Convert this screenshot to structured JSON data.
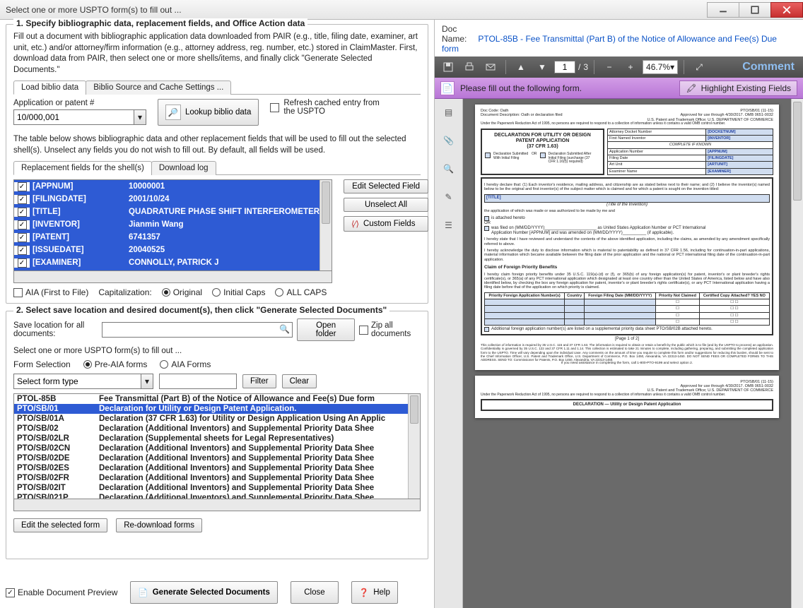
{
  "window": {
    "title": "Select one or more USPTO form(s) to fill out ..."
  },
  "section1": {
    "legend": "1. Specify bibliographic data, replacement fields, and Office Action data",
    "desc": "Fill out a document with bibliographic application data downloaded from PAIR (e.g., title, filing date, examiner, art unit, etc.) and/or attorney/firm information (e.g., attorney address, reg. number, etc.) stored in ClaimMaster. First, download data from PAIR, then select one or more shells/items, and finally click \"Generate Selected Documents.\"",
    "tabs": {
      "active": "Load biblio data",
      "other": "Biblio Source and Cache Settings ..."
    },
    "appnum_label": "Application or patent #",
    "appnum_value": "10/000,001",
    "lookup_btn": "Lookup biblio data",
    "refresh_label": "Refresh cached entry from the USPTO",
    "table_intro": "The table below shows bibliographic data and other replacement fields that will be used to fill out the selected shell(s). Unselect any fields you do not wish to fill out. By default, all fields will be used.",
    "rep_tabs": {
      "active": "Replacement fields for the shell(s)",
      "other": "Download log"
    },
    "fields": [
      {
        "key": "[APPNUM]",
        "val": "10000001"
      },
      {
        "key": "[FILINGDATE]",
        "val": "2001/10/24"
      },
      {
        "key": "[TITLE]",
        "val": "QUADRATURE PHASE SHIFT INTERFEROMETER"
      },
      {
        "key": "[INVENTOR]",
        "val": "Jianmin  Wang"
      },
      {
        "key": "[PATENT]",
        "val": "6741357"
      },
      {
        "key": "[ISSUEDATE]",
        "val": "20040525"
      },
      {
        "key": "[EXAMINER]",
        "val": "CONNOLLY, PATRICK J"
      }
    ],
    "edit_btn": "Edit Selected Field",
    "unselect_btn": "Unselect All",
    "custom_btn": "Custom Fields",
    "aia_label": "AIA (First to File)",
    "cap_label": "Capitalization:",
    "cap_opts": {
      "orig": "Original",
      "init": "Initial Caps",
      "caps": "ALL CAPS"
    }
  },
  "section2": {
    "legend": "2. Select save location and desired document(s), then click \"Generate Selected Documents\"",
    "save_label": "Save location for all documents:",
    "save_value": "",
    "open_folder": "Open folder",
    "zip_label": "Zip all documents",
    "select_hint": "Select one or more USPTO form(s) to fill out ...",
    "formsel_label": "Form Selection",
    "pre_aia": "Pre-AIA forms",
    "aia_forms": "AIA Forms",
    "formtype_placeholder": "Select form type",
    "filter_placeholder": "",
    "filter_btn": "Filter",
    "clear_btn": "Clear",
    "forms": [
      {
        "id": "PTOL-85B",
        "name": "Fee Transmittal (Part B) of the Notice of Allowance and Fee(s) Due form",
        "sel": false,
        "hdr": true
      },
      {
        "id": "PTO/SB/01",
        "name": "Declaration for Utility or Design Patent Application.",
        "sel": true
      },
      {
        "id": "PTO/SB/01A",
        "name": "Declaration (37 CFR 1.63) for Utility or Design Application Using An Applic"
      },
      {
        "id": "PTO/SB/02",
        "name": "Declaration (Additional Inventors) and Supplemental Priority Data Shee"
      },
      {
        "id": "PTO/SB/02LR",
        "name": "Declaration (Supplemental sheets for Legal Representatives)"
      },
      {
        "id": "PTO/SB/02CN",
        "name": "Declaration (Additional Inventors) and Supplemental Priority Data Shee"
      },
      {
        "id": "PTO/SB/02DE",
        "name": "Declaration (Additional Inventors) and Supplemental Priority Data Shee"
      },
      {
        "id": "PTO/SB/02ES",
        "name": "Declaration (Additional Inventors) and Supplemental Priority Data Shee"
      },
      {
        "id": "PTO/SB/02FR",
        "name": "Declaration (Additional Inventors) and Supplemental Priority Data Shee"
      },
      {
        "id": "PTO/SB/02IT",
        "name": "Declaration (Additional Inventors) and Supplemental Priority Data Shee"
      },
      {
        "id": "PTO/SB/021P",
        "name": "Declaration (Additional Inventors) and Supplemental Priority Data Shee"
      }
    ],
    "edit_form_btn": "Edit the selected form",
    "redownload_btn": "Re-download forms"
  },
  "bottom": {
    "preview_label": "Enable Document Preview",
    "generate_btn": "Generate Selected Documents",
    "close_btn": "Close",
    "help_btn": "Help"
  },
  "right": {
    "docname_lbl": "Doc Name:",
    "docname_val": "PTOL-85B - Fee Transmittal (Part B) of the Notice of Allowance and Fee(s) Due form",
    "page_cur": "1",
    "page_total": "3",
    "zoom": "46.7%",
    "comment": "Comment",
    "banner": "Please fill out the following form.",
    "highlight_btn": "Highlight Existing Fields",
    "pdf": {
      "doccode": "Doc Code: Oath",
      "docdesc": "Document Description: Oath or declaration filed",
      "approved": "Approved for use through 4/30/2017. OMB 0651-0032",
      "agency": "U.S. Patent and Trademark Office; U.S. DEPARTMENT OF COMMERCE",
      "pra": "Under the Paperwork Reduction Act of 1995, no persons are required to respond to a collection of information unless it contains a valid OMB control number.",
      "decl1": "DECLARATION FOR UTILITY OR DESIGN",
      "decl2": "PATENT APPLICATION",
      "decl3": "(37 CFR 1.63)",
      "subA": "Declaration Submitted With Initial Filing",
      "subOR": "OR",
      "subB": "Declaration Submitted After Initial Filing (surcharge (37 CFR 1.16(f)) required)",
      "rows": {
        "r1l": "Attorney Docket Number",
        "r1v": "[DOCKETNUM]",
        "r2l": "First Named Inventor",
        "r2v": "[INVENTOR]",
        "r2c": "COMPLETE IF KNOWN",
        "r3l": "Application Number",
        "r3v": "[APPNUM]",
        "r4l": "Filing Date",
        "r4v": "[FILINGDATE]",
        "r5l": "Art Unit",
        "r5v": "[ARTUNIT]",
        "r6l": "Examiner Name",
        "r6v": "[EXAMINER]"
      },
      "para1": "I hereby declare that: (1) Each inventor's residence, mailing address, and citizenship are as stated below next to their name; and (2) I believe the inventor(s) named below to be the original and first inventor(s) of the subject matter which is claimed and for which a patent is sought on the invention titled:",
      "title_ph": "[TITLE]",
      "title_cap": "(Title of the Invention)",
      "para2": "the application of which was made or was authorized to be made by me and",
      "chkA": "is attached hereto",
      "or": "OR",
      "chkB": "was filed on (MM/DD/YYYY)______________________ as United States Application Number or PCT International",
      "chkB2": "Application Number [APPNUM]                                     and was amended on (MM/DD/YYYY)__________ (if applicable).",
      "para3": "I hereby state that I have reviewed and understand the contents of the above identified application, including the claims, as amended by any amendment specifically referred to above.",
      "para4": "I hereby acknowledge the duty to disclose information which is material to patentability as defined in 37 CFR 1.56, including for continuation-in-part applications, material information which became available between the filing date of the prior application and the national or PCT international filing date of the continuation-in-part application.",
      "claim_hdr": "Claim of Foreign Priority Benefits",
      "para5": "I hereby claim foreign priority benefits under 35 U.S.C. 119(a)-(d) or (f), or 365(b) of any foreign application(s) for patent, inventor's or plant breeder's rights certificate(s), or 365(a) of any PCT international application which designated at least one country other than the United States of America, listed below and have also identified below, by checking the box any foreign application for patent, inventor's or plant breeder's rights certificate(s), or any PCT International application having a filing date before that of the application on which priority is claimed.",
      "th1": "Priority Foreign Application Number(s)",
      "th2": "Country",
      "th3": "Foreign Filing Date (MM/DD/YYYY)",
      "th4": "Priority Not Claimed",
      "th5": "Certified Copy Attached? YES        NO",
      "addl": "Additional foreign application number(s) are listed on a supplemental priority data sheet PTO/SB/02B attached hereto.",
      "pageof": "[Page 1 of 2]",
      "fine": "This collection of information is required by 35 U.S.C. 115 and 37 CFR 1.63. The information is required to obtain or retain a benefit by the public which is to file (and by the USPTO to process) an application. Confidentiality is governed by 35 U.S.C. 122 and 37 CFR 1.11 and 1.14. This collection is estimated to take 21 minutes to complete, including gathering, preparing, and submitting the completed application form to the USPTO. Time will vary depending upon the individual case. Any comments on the amount of time you require to complete this form and/or suggestions for reducing this burden, should be sent to the Chief Information Officer, U.S. Patent and Trademark Office, U.S. Department of Commerce, P.O. Box 1450, Alexandria, VA 22313-1450. DO NOT SEND FEES OR COMPLETED FORMS TO THIS ADDRESS. SEND TO: Commissioner for Patents, P.O. Box 1450, Alexandria, VA 22313-1450.",
      "assist": "If you need assistance in completing the form, call 1-800-PTO-9199 and select option 2.",
      "p2title": "DECLARATION — Utility or Design Patent Application"
    }
  }
}
